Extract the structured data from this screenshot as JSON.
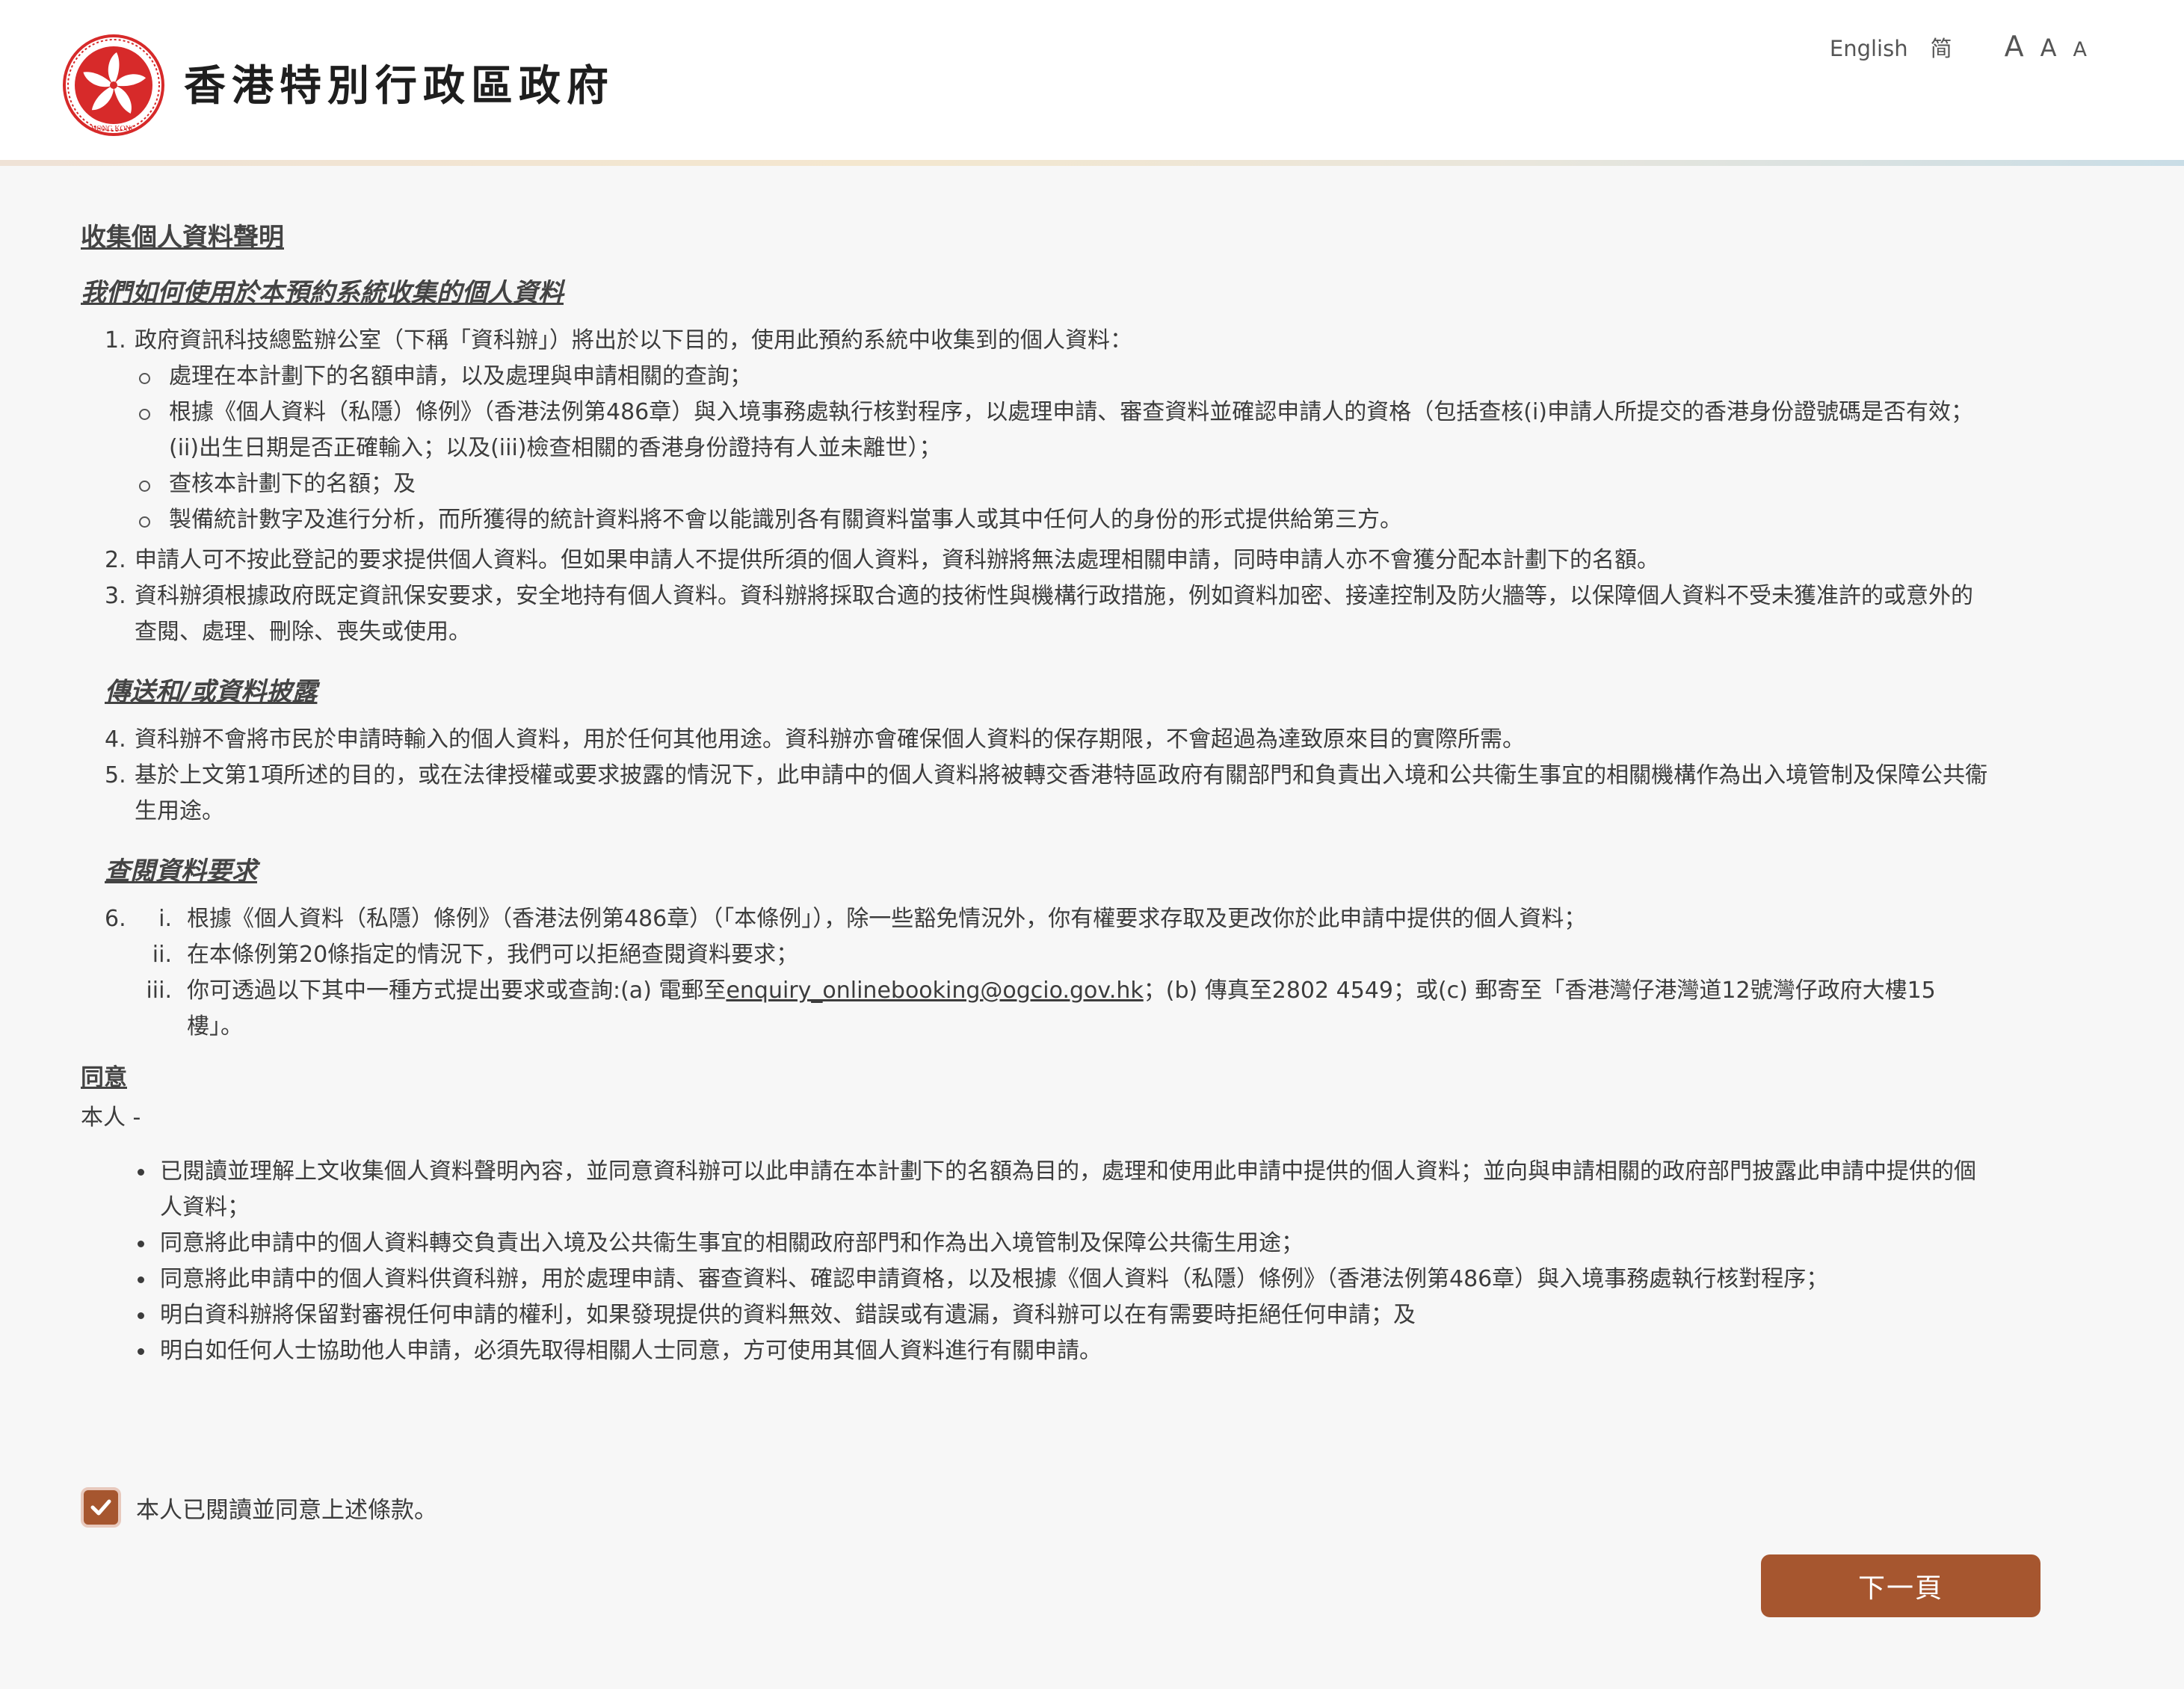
{
  "header": {
    "gov_title": "香港特別行政區政府",
    "emblem_text": "HONG KONG",
    "lang_english": "English",
    "lang_simplified": "简",
    "font_large": "A",
    "font_medium": "A",
    "font_small": "A"
  },
  "statement": {
    "title": "收集個人資料聲明",
    "section_use_title": "我們如何使用於本預約系統收集的個人資料",
    "item1": {
      "num": "1.",
      "text": "政府資訊科技總監辦公室（下稱「資科辦」）將出於以下目的，使用此預約系統中收集到的個人資料：",
      "subs": [
        "處理在本計劃下的名額申請，以及處理與申請相關的查詢；",
        "根據《個人資料（私隱）條例》（香港法例第486章）與入境事務處執行核對程序，以處理申請、審查資料並確認申請人的資格（包括查核(i)申請人所提交的香港身份證號碼是否有效；(ii)出生日期是否正確輸入；以及(iii)檢查相關的香港身份證持有人並未離世）；",
        "查核本計劃下的名額；及",
        "製備統計數字及進行分析，而所獲得的統計資料將不會以能識別各有關資料當事人或其中任何人的身份的形式提供給第三方。"
      ]
    },
    "item2": {
      "num": "2.",
      "text": "申請人可不按此登記的要求提供個人資料。但如果申請人不提供所須的個人資料，資科辦將無法處理相關申請，同時申請人亦不會獲分配本計劃下的名額。"
    },
    "item3": {
      "num": "3.",
      "text": "資科辦須根據政府既定資訊保安要求，安全地持有個人資料。資科辦將採取合適的技術性與機構行政措施，例如資料加密、接達控制及防火牆等，以保障個人資料不受未獲准許的或意外的查閱、處理、刪除、喪失或使用。"
    },
    "section_transfer_title": "傳送和/或資料披露",
    "item4": {
      "num": "4.",
      "text": "資科辦不會將市民於申請時輸入的個人資料，用於任何其他用途。資科辦亦會確保個人資料的保存期限，不會超過為達致原來目的實際所需。"
    },
    "item5": {
      "num": "5.",
      "text": "基於上文第1項所述的目的，或在法律授權或要求披露的情況下，此申請中的個人資料將被轉交香港特區政府有關部門和負責出入境和公共衞生事宜的相關機構作為出入境管制及保障公共衞生用途。"
    },
    "section_access_title": "查閱資料要求",
    "item6": {
      "num": "6.",
      "i_num": "i.",
      "i_text": "根據《個人資料（私隱）條例》（香港法例第486章）（「本條例」），除一些豁免情況外，你有權要求存取及更改你於此申請中提供的個人資料；",
      "ii_num": "ii.",
      "ii_text": "在本條例第20條指定的情況下，我們可以拒絕查閱資料要求；",
      "iii_num": "iii.",
      "iii_before": "你可透過以下其中一種方式提出要求或查詢:(a) 電郵至",
      "iii_email": "enquiry_onlinebooking@ogcio.gov.hk",
      "iii_after": "；(b) 傳真至2802 4549；或(c) 郵寄至「香港灣仔港灣道12號灣仔政府大樓15樓」。"
    }
  },
  "consent": {
    "title": "同意",
    "self": "本人 -",
    "bullets": [
      "已閱讀並理解上文收集個人資料聲明內容，並同意資科辦可以此申請在本計劃下的名額為目的，處理和使用此申請中提供的個人資料；並向與申請相關的政府部門披露此申請中提供的個人資料；",
      "同意將此申請中的個人資料轉交負責出入境及公共衞生事宜的相關政府部門和作為出入境管制及保障公共衞生用途；",
      "同意將此申請中的個人資料供資科辦，用於處理申請、審查資料、確認申請資格，以及根據《個人資料（私隱）條例》（香港法例第486章）與入境事務處執行核對程序；",
      "明白資科辦將保留對審視任何申請的權利，如果發現提供的資料無效、錯誤或有遺漏，資科辦可以在有需要時拒絕任何申請；及",
      "明白如任何人士協助他人申請，必須先取得相關人士同意，方可使用其個人資料進行有關申請。"
    ],
    "agree_label": "本人已閱讀並同意上述條款。",
    "agree_checked": true
  },
  "actions": {
    "next_label": "下一頁",
    "accent_color": "#a6562f"
  }
}
